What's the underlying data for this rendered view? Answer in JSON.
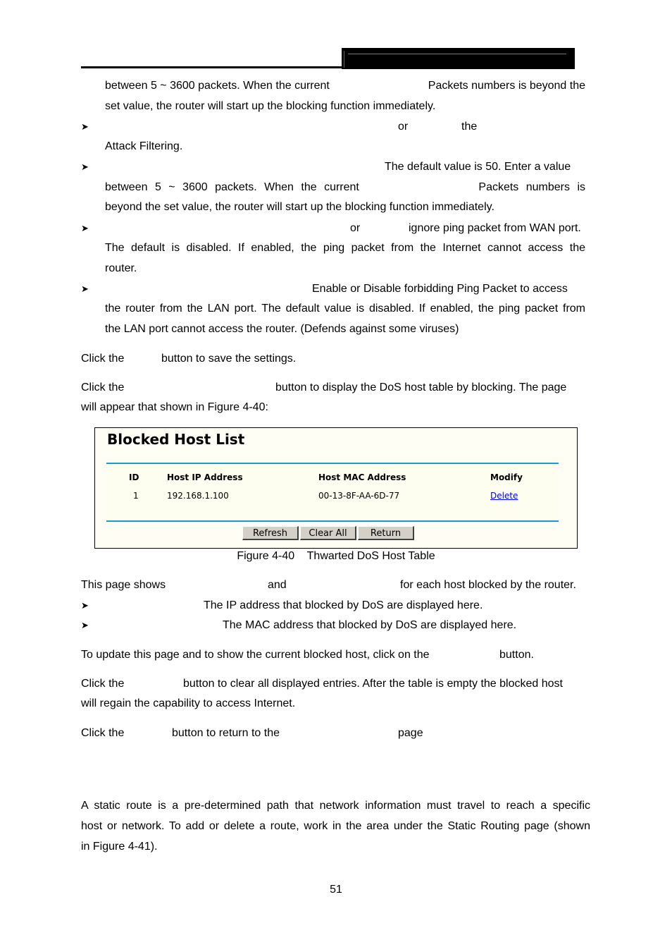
{
  "header": {},
  "bullets_top": {
    "p0_line1_left": "between 5 ~ 3600 packets. When the current",
    "p0_line1_right": "Packets numbers is beyond the",
    "p0_line2": "set value, the router will start up the blocking function immediately.",
    "b1_mid1": "or",
    "b1_mid2": "the",
    "b1_line2": "Attack Filtering.",
    "b2_right": "The default value is 50. Enter a value",
    "b2_line2_left": "between 5 ~ 3600 packets. When the current",
    "b2_line2_right": "Packets numbers is",
    "b2_line3": "beyond the set value, the router will start up the blocking function immediately.",
    "b3_mid": "or",
    "b3_right": "ignore ping packet from WAN port.",
    "b3_line2": "The default is disabled. If enabled, the ping packet from the Internet cannot access the",
    "b3_line3": "router.",
    "b4_right": "Enable or Disable forbidding Ping Packet to access",
    "b4_line2": "the router from the LAN port. The default value is disabled. If enabled, the ping packet from",
    "b4_line3": "the LAN port cannot access the router. (Defends against some viruses)"
  },
  "para_save": {
    "left": "Click the",
    "right": "button to save the settings."
  },
  "para_display": {
    "left": "Click the",
    "right": "button to display the DoS host table by blocking. The page",
    "line2": "will appear that shown in Figure 4-40:"
  },
  "figure": {
    "title": "Blocked Host List",
    "columns": [
      "ID",
      "Host IP Address",
      "Host MAC Address",
      "Modify"
    ],
    "rows": [
      {
        "id": "1",
        "ip": "192.168.1.100",
        "mac": "00-13-8F-AA-6D-77",
        "action": "Delete"
      }
    ],
    "buttons": {
      "refresh": "Refresh",
      "clear_all": "Clear All",
      "return": "Return"
    },
    "caption": "Figure 4-40    Thwarted DoS Host Table"
  },
  "para_shows": {
    "left": "This page shows",
    "mid": "and",
    "right": "for each host blocked by the router."
  },
  "bullets_bottom": {
    "ip": "The IP address that blocked by DoS are displayed here.",
    "mac": "The MAC address that blocked by DoS are displayed here."
  },
  "para_update": {
    "left": "To update this page and to show the current blocked host, click on the",
    "right": "button."
  },
  "para_clear": {
    "left": "Click the",
    "right": "button to clear all displayed entries. After the table is empty the blocked host",
    "line2": "will regain the capability to access Internet."
  },
  "para_return": {
    "left": "Click the",
    "mid": "button to return to the",
    "right": "page"
  },
  "para_static": {
    "line1": "A static route is a pre-determined path that network information must travel to reach a specific",
    "line2": "host or network. To add or delete a route, work in the area under the Static Routing page (shown",
    "line3": "in Figure 4-41)."
  },
  "page_number": "51",
  "colors": {
    "accent_rule": "#1a9ccc",
    "panel_bg": "#fefef4",
    "link": "#0000ee",
    "button_bg": "#d4d0c8"
  }
}
